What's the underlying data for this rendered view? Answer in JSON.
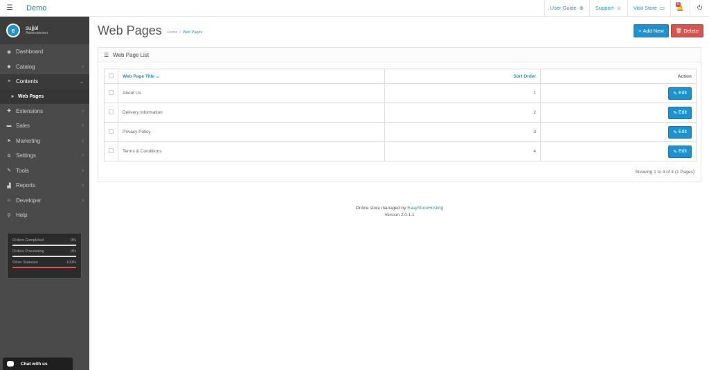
{
  "header": {
    "brand": "Demo",
    "user_guide": "User Guide",
    "support": "Support",
    "visit_store": "Visit Store",
    "notification_count": "0"
  },
  "sidebar": {
    "user_name": "sujjal",
    "user_role": "Administrator",
    "items": [
      {
        "label": "Dashboard",
        "icon": "dashboard-icon"
      },
      {
        "label": "Catalog",
        "icon": "tag-icon"
      },
      {
        "label": "Contents",
        "icon": "list-icon"
      },
      {
        "label": "Web Pages",
        "icon": "double-chevron-icon"
      },
      {
        "label": "Extensions",
        "icon": "puzzle-icon"
      },
      {
        "label": "Sales",
        "icon": "cart-icon"
      },
      {
        "label": "Marketing",
        "icon": "send-icon"
      },
      {
        "label": "Settings",
        "icon": "gear-icon"
      },
      {
        "label": "Tools",
        "icon": "wrench-icon"
      },
      {
        "label": "Reports",
        "icon": "chart-icon"
      },
      {
        "label": "Developer",
        "icon": "code-icon"
      },
      {
        "label": "Help",
        "icon": "search-icon"
      }
    ],
    "stats": [
      {
        "label": "Orders Completed",
        "value": "0%"
      },
      {
        "label": "Orders Processing",
        "value": "0%"
      },
      {
        "label": "Other Statuses",
        "value": "100%"
      }
    ],
    "chat_label": "Chat with us"
  },
  "page": {
    "title": "Web Pages",
    "breadcrumb_home": "Home",
    "breadcrumb_current": "Web Pages",
    "add_new": "Add New",
    "delete": "Delete"
  },
  "panel": {
    "title": "Web Page List",
    "columns": {
      "title": "Web Page Title",
      "sort": "Sort Order",
      "action": "Action"
    },
    "rows": [
      {
        "title": "About Us",
        "sort": "1",
        "edit": "Edit"
      },
      {
        "title": "Delivery Information",
        "sort": "2",
        "edit": "Edit"
      },
      {
        "title": "Privacy Policy",
        "sort": "3",
        "edit": "Edit"
      },
      {
        "title": "Terms & Conditions",
        "sort": "4",
        "edit": "Edit"
      }
    ],
    "pagination": "Showing 1 to 4 of 4 (1 Pages)"
  },
  "footer": {
    "line1_prefix": "Online store managed by ",
    "line1_link": "EasyStoreHosting",
    "line2": "Version 2.0.1.1"
  },
  "colors": {
    "accent": "#1e91cf",
    "danger": "#d9534f",
    "sidebar_bg": "#4a4a4a"
  }
}
